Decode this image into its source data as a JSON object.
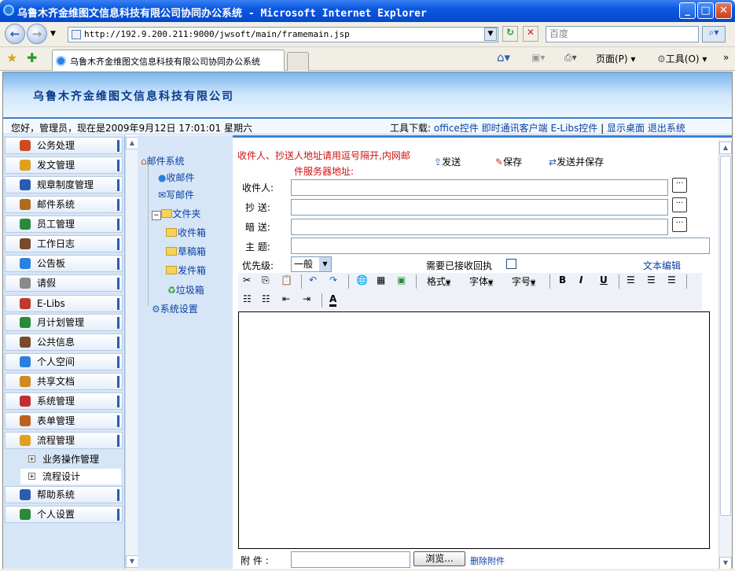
{
  "window": {
    "title": "乌鲁木齐金维图文信息科技有限公司协同办公系统 - Microsoft Internet Explorer"
  },
  "browser": {
    "url": "http://192.9.200.211:9000/jwsoft/main/framemain.jsp",
    "search_placeholder": "百度",
    "tab_title": "乌鲁木齐金维图文信息科技有限公司协同办公系统",
    "page_menu": "页面(P)",
    "tools_menu": "工具(O)"
  },
  "header": {
    "company": "乌鲁木齐金维图文信息科技有限公司",
    "greeting": "您好，管理员，现在是2009年9月12日  17:01:01 星期六",
    "tools_label": "工具下载:",
    "links": [
      "office控件",
      "即时通讯客户端",
      "E-Libs控件",
      "|",
      "显示桌面",
      "退出系统"
    ]
  },
  "menu": {
    "items": [
      {
        "label": "公务处理",
        "color": "#d04a20"
      },
      {
        "label": "发文管理",
        "color": "#e0a020"
      },
      {
        "label": "规章制度管理",
        "color": "#2a5db0"
      },
      {
        "label": "邮件系统",
        "color": "#b06a20"
      },
      {
        "label": "员工管理",
        "color": "#2a8a3a"
      },
      {
        "label": "工作日志",
        "color": "#7a4a2a"
      },
      {
        "label": "公告板",
        "color": "#2a7fe0"
      },
      {
        "label": "请假",
        "color": "#8a8a8a"
      },
      {
        "label": "E-Libs",
        "color": "#c0392b"
      },
      {
        "label": "月计划管理",
        "color": "#2a8a3a"
      },
      {
        "label": "公共信息",
        "color": "#7a4a2a"
      },
      {
        "label": "个人空间",
        "color": "#2a7fe0"
      },
      {
        "label": "共享文档",
        "color": "#d08a20"
      },
      {
        "label": "系统管理",
        "color": "#c03030"
      },
      {
        "label": "表单管理",
        "color": "#c06020"
      },
      {
        "label": "流程管理",
        "color": "#e0a020"
      }
    ],
    "subitems": [
      "业务操作管理",
      "流程设计"
    ],
    "bottom_items": [
      {
        "label": "帮助系统",
        "color": "#2a5db0"
      },
      {
        "label": "个人设置",
        "color": "#2a8a3a"
      }
    ]
  },
  "tree": {
    "root": "邮件系统",
    "inbox": "收邮件",
    "compose": "写邮件",
    "folder": "文件夹",
    "folders": [
      "收件箱",
      "草稿箱",
      "发件箱",
      "垃圾箱"
    ],
    "settings": "系统设置"
  },
  "compose": {
    "hint_line1": "收件人、抄送人地址请用逗号隔开,内网邮",
    "hint_line2": "件服务器地址:",
    "send": "发送",
    "save": "保存",
    "send_save": "发送并保存",
    "to_label": "收件人:",
    "cc_label": "抄  送:",
    "bcc_label": "暗  送:",
    "subject_label": "主  题:",
    "priority_label": "优先级:",
    "priority_value": "一般",
    "receipt_label": "需要已接收回执",
    "text_edit": "文本编辑",
    "format": "格式",
    "font": "字体",
    "size": "字号",
    "attach_label": "附  件 :",
    "browse": "浏览...",
    "delete_attach": "删除附件",
    "dots": "···"
  }
}
